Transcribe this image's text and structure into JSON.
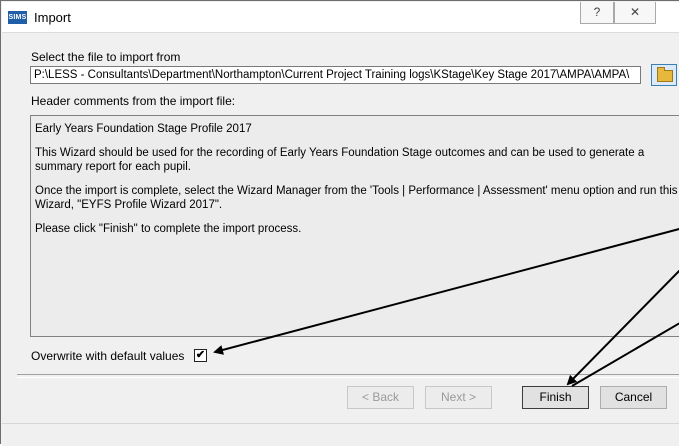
{
  "window": {
    "app_icon_text": "SIMS",
    "title": "Import",
    "help_glyph": "?",
    "close_glyph": "✕"
  },
  "file_section": {
    "label": "Select the file to import from",
    "path": "P:\\LESS - Consultants\\Department\\Northampton\\Current Project Training logs\\KStage\\Key Stage 2017\\AMPA\\AMPA\\"
  },
  "comments_section": {
    "label": "Header comments from the import file:",
    "paragraphs": [
      "Early Years Foundation Stage Profile 2017",
      "This Wizard should be used for the recording of Early Years Foundation Stage outcomes and can be used to generate a summary report for each pupil.",
      "Once the import is complete, select the Wizard Manager from the 'Tools | Performance | Assessment' menu option and run this Wizard, \"EYFS Profile Wizard 2017\".",
      "Please click \"Finish\" to complete the import process."
    ]
  },
  "options": {
    "overwrite_label": "Overwrite with default values",
    "overwrite_checked": true,
    "check_glyph": "✔"
  },
  "buttons": {
    "back": "< Back",
    "next": "Next >",
    "finish": "Finish",
    "cancel": "Cancel"
  }
}
